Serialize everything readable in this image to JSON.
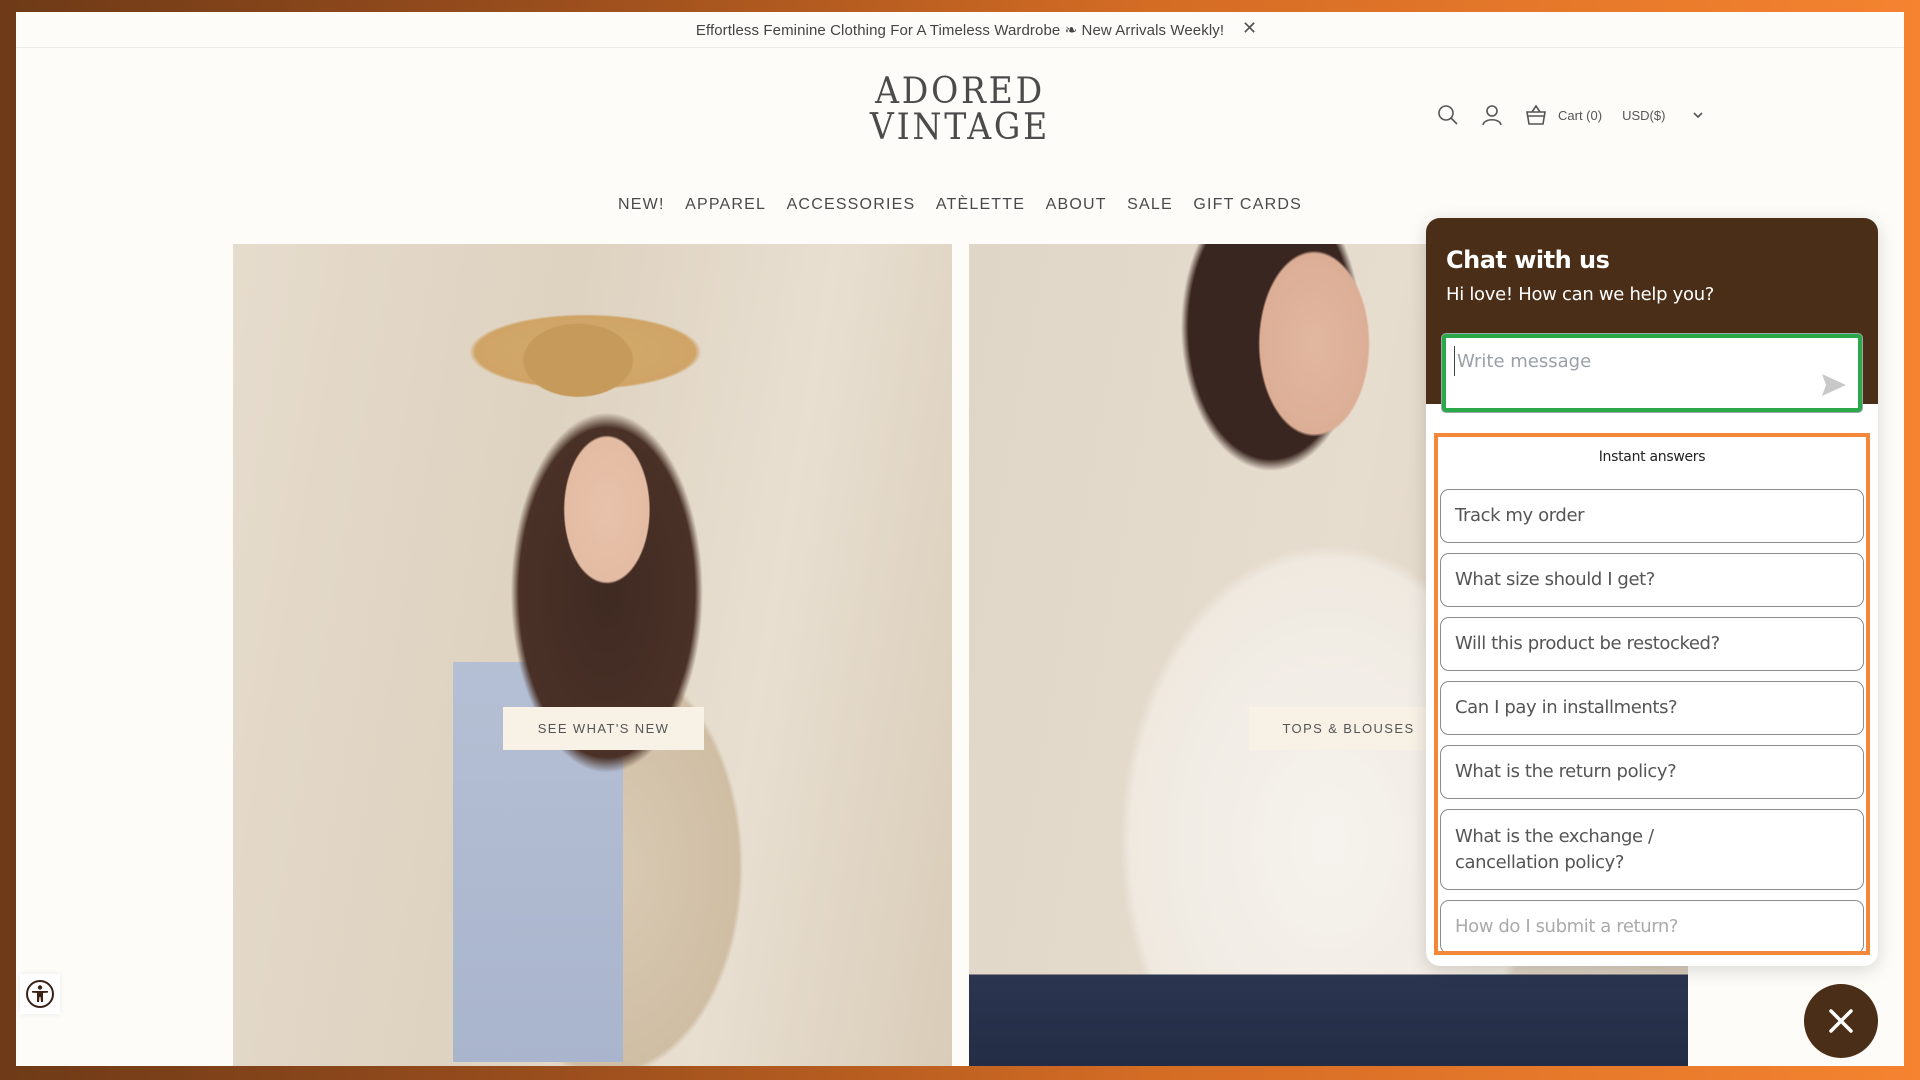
{
  "announcement": {
    "text": "Effortless Feminine Clothing For A Timeless Wardrobe ❧ New Arrivals Weekly!",
    "close_icon": "close-icon"
  },
  "header": {
    "logo_line1": "ADORED",
    "logo_line2": "VINTAGE",
    "icons": [
      "search-icon",
      "user-icon",
      "cart-icon"
    ],
    "cart_label": "Cart (0)",
    "currency": "USD($)"
  },
  "nav": {
    "items": [
      "NEW!",
      "APPAREL",
      "ACCESSORIES",
      "ATÈLETTE",
      "ABOUT",
      "SALE",
      "GIFT CARDS"
    ]
  },
  "hero": {
    "left_button": "SEE WHAT'S NEW",
    "right_button": "TOPS & BLOUSES"
  },
  "chat": {
    "title": "Chat with us",
    "subtitle": "Hi love! How can we help you?",
    "input_placeholder": "Write message",
    "input_value": "",
    "instant_answers_title": "Instant answers",
    "answers": [
      "Track my order",
      "What size should I get?",
      "Will this product be restocked?",
      "Can I pay in installments?",
      "What is the return policy?",
      "What is the exchange / cancellation policy?",
      "How do I submit a return?"
    ],
    "colors": {
      "header_bg": "#4a2e17",
      "input_highlight": "#2ba84a",
      "answers_highlight": "#f3873a"
    }
  }
}
